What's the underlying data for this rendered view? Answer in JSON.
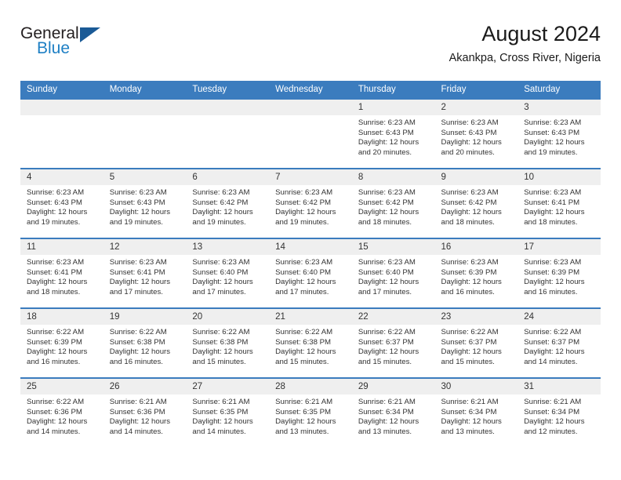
{
  "brand": {
    "name_part1": "General",
    "name_part2": "Blue",
    "logo_icon": "blue-triangle-icon"
  },
  "header": {
    "title": "August 2024",
    "subtitle": "Akankpa, Cross River, Nigeria"
  },
  "colors": {
    "header_blue": "#3b7cbe",
    "brand_blue": "#1d7fc4",
    "logo_dark_blue": "#1a5a96",
    "daynum_bg": "#efefef",
    "text": "#333333"
  },
  "weekdays": [
    "Sunday",
    "Monday",
    "Tuesday",
    "Wednesday",
    "Thursday",
    "Friday",
    "Saturday"
  ],
  "weeks": [
    [
      {
        "day": "",
        "lines": []
      },
      {
        "day": "",
        "lines": []
      },
      {
        "day": "",
        "lines": []
      },
      {
        "day": "",
        "lines": []
      },
      {
        "day": "1",
        "lines": [
          "Sunrise: 6:23 AM",
          "Sunset: 6:43 PM",
          "Daylight: 12 hours and 20 minutes."
        ]
      },
      {
        "day": "2",
        "lines": [
          "Sunrise: 6:23 AM",
          "Sunset: 6:43 PM",
          "Daylight: 12 hours and 20 minutes."
        ]
      },
      {
        "day": "3",
        "lines": [
          "Sunrise: 6:23 AM",
          "Sunset: 6:43 PM",
          "Daylight: 12 hours and 19 minutes."
        ]
      }
    ],
    [
      {
        "day": "4",
        "lines": [
          "Sunrise: 6:23 AM",
          "Sunset: 6:43 PM",
          "Daylight: 12 hours and 19 minutes."
        ]
      },
      {
        "day": "5",
        "lines": [
          "Sunrise: 6:23 AM",
          "Sunset: 6:43 PM",
          "Daylight: 12 hours and 19 minutes."
        ]
      },
      {
        "day": "6",
        "lines": [
          "Sunrise: 6:23 AM",
          "Sunset: 6:42 PM",
          "Daylight: 12 hours and 19 minutes."
        ]
      },
      {
        "day": "7",
        "lines": [
          "Sunrise: 6:23 AM",
          "Sunset: 6:42 PM",
          "Daylight: 12 hours and 19 minutes."
        ]
      },
      {
        "day": "8",
        "lines": [
          "Sunrise: 6:23 AM",
          "Sunset: 6:42 PM",
          "Daylight: 12 hours and 18 minutes."
        ]
      },
      {
        "day": "9",
        "lines": [
          "Sunrise: 6:23 AM",
          "Sunset: 6:42 PM",
          "Daylight: 12 hours and 18 minutes."
        ]
      },
      {
        "day": "10",
        "lines": [
          "Sunrise: 6:23 AM",
          "Sunset: 6:41 PM",
          "Daylight: 12 hours and 18 minutes."
        ]
      }
    ],
    [
      {
        "day": "11",
        "lines": [
          "Sunrise: 6:23 AM",
          "Sunset: 6:41 PM",
          "Daylight: 12 hours and 18 minutes."
        ]
      },
      {
        "day": "12",
        "lines": [
          "Sunrise: 6:23 AM",
          "Sunset: 6:41 PM",
          "Daylight: 12 hours and 17 minutes."
        ]
      },
      {
        "day": "13",
        "lines": [
          "Sunrise: 6:23 AM",
          "Sunset: 6:40 PM",
          "Daylight: 12 hours and 17 minutes."
        ]
      },
      {
        "day": "14",
        "lines": [
          "Sunrise: 6:23 AM",
          "Sunset: 6:40 PM",
          "Daylight: 12 hours and 17 minutes."
        ]
      },
      {
        "day": "15",
        "lines": [
          "Sunrise: 6:23 AM",
          "Sunset: 6:40 PM",
          "Daylight: 12 hours and 17 minutes."
        ]
      },
      {
        "day": "16",
        "lines": [
          "Sunrise: 6:23 AM",
          "Sunset: 6:39 PM",
          "Daylight: 12 hours and 16 minutes."
        ]
      },
      {
        "day": "17",
        "lines": [
          "Sunrise: 6:23 AM",
          "Sunset: 6:39 PM",
          "Daylight: 12 hours and 16 minutes."
        ]
      }
    ],
    [
      {
        "day": "18",
        "lines": [
          "Sunrise: 6:22 AM",
          "Sunset: 6:39 PM",
          "Daylight: 12 hours and 16 minutes."
        ]
      },
      {
        "day": "19",
        "lines": [
          "Sunrise: 6:22 AM",
          "Sunset: 6:38 PM",
          "Daylight: 12 hours and 16 minutes."
        ]
      },
      {
        "day": "20",
        "lines": [
          "Sunrise: 6:22 AM",
          "Sunset: 6:38 PM",
          "Daylight: 12 hours and 15 minutes."
        ]
      },
      {
        "day": "21",
        "lines": [
          "Sunrise: 6:22 AM",
          "Sunset: 6:38 PM",
          "Daylight: 12 hours and 15 minutes."
        ]
      },
      {
        "day": "22",
        "lines": [
          "Sunrise: 6:22 AM",
          "Sunset: 6:37 PM",
          "Daylight: 12 hours and 15 minutes."
        ]
      },
      {
        "day": "23",
        "lines": [
          "Sunrise: 6:22 AM",
          "Sunset: 6:37 PM",
          "Daylight: 12 hours and 15 minutes."
        ]
      },
      {
        "day": "24",
        "lines": [
          "Sunrise: 6:22 AM",
          "Sunset: 6:37 PM",
          "Daylight: 12 hours and 14 minutes."
        ]
      }
    ],
    [
      {
        "day": "25",
        "lines": [
          "Sunrise: 6:22 AM",
          "Sunset: 6:36 PM",
          "Daylight: 12 hours and 14 minutes."
        ]
      },
      {
        "day": "26",
        "lines": [
          "Sunrise: 6:21 AM",
          "Sunset: 6:36 PM",
          "Daylight: 12 hours and 14 minutes."
        ]
      },
      {
        "day": "27",
        "lines": [
          "Sunrise: 6:21 AM",
          "Sunset: 6:35 PM",
          "Daylight: 12 hours and 14 minutes."
        ]
      },
      {
        "day": "28",
        "lines": [
          "Sunrise: 6:21 AM",
          "Sunset: 6:35 PM",
          "Daylight: 12 hours and 13 minutes."
        ]
      },
      {
        "day": "29",
        "lines": [
          "Sunrise: 6:21 AM",
          "Sunset: 6:34 PM",
          "Daylight: 12 hours and 13 minutes."
        ]
      },
      {
        "day": "30",
        "lines": [
          "Sunrise: 6:21 AM",
          "Sunset: 6:34 PM",
          "Daylight: 12 hours and 13 minutes."
        ]
      },
      {
        "day": "31",
        "lines": [
          "Sunrise: 6:21 AM",
          "Sunset: 6:34 PM",
          "Daylight: 12 hours and 12 minutes."
        ]
      }
    ]
  ]
}
